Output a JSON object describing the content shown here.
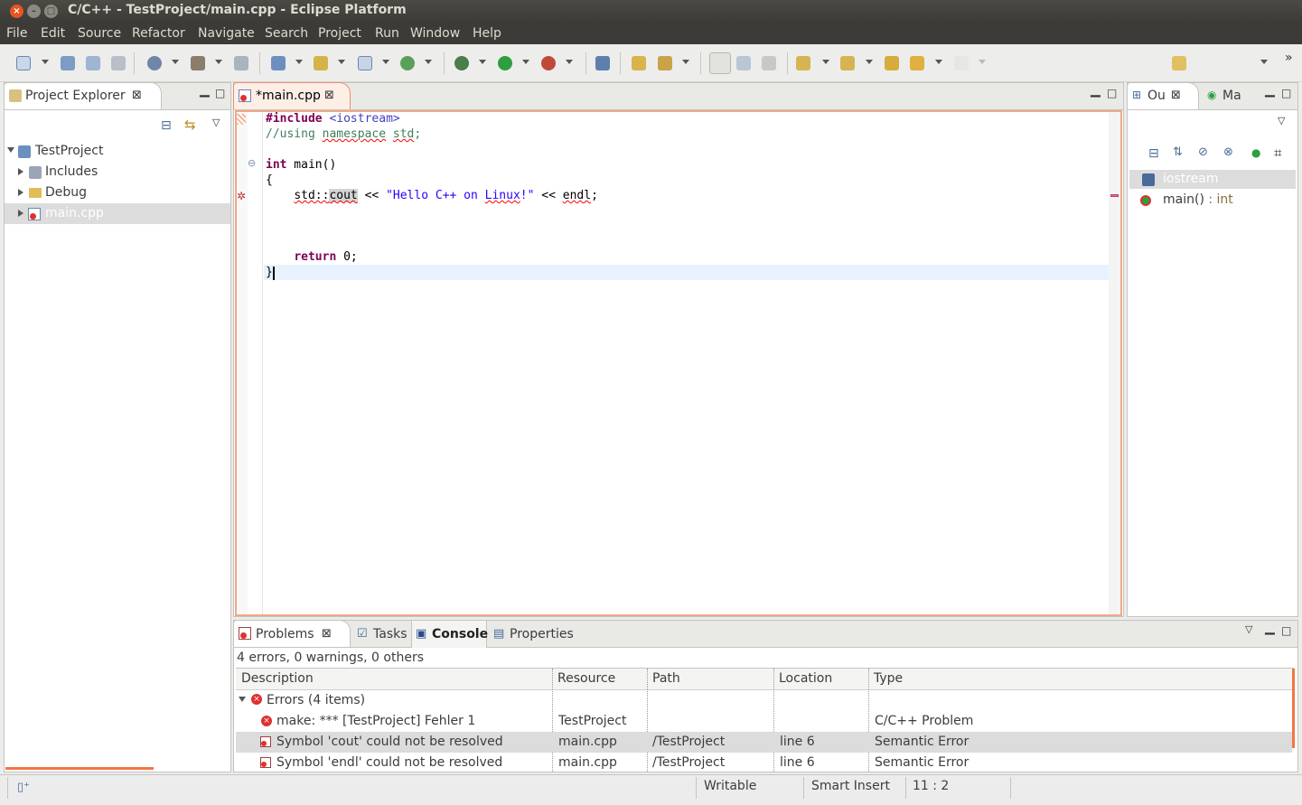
{
  "window": {
    "title": "C/C++ - TestProject/main.cpp - Eclipse Platform"
  },
  "menu": [
    "File",
    "Edit",
    "Source",
    "Refactor",
    "Navigate",
    "Search",
    "Project",
    "Run",
    "Window",
    "Help"
  ],
  "explorer": {
    "title": "Project Explorer",
    "project": "TestProject",
    "items": [
      {
        "label": "Includes",
        "icon": "includes-icon"
      },
      {
        "label": "Debug",
        "icon": "folder-icon"
      },
      {
        "label": "main.cpp",
        "icon": "cpp-file-error-icon"
      }
    ]
  },
  "editor": {
    "tab": "*main.cpp",
    "lines": {
      "l1_kw": "#include",
      "l1_inc": "<iostream>",
      "l2_pre": "//using ",
      "l2_ns": "namespace",
      "l2_sp": " ",
      "l2_std": "std",
      "l2_end": ";",
      "l4_kw": "int",
      "l4_rest": " main()",
      "l5": "{",
      "l6_indent": "    ",
      "l6_std": "std::",
      "l6_cout": "cout",
      "l6_op": " << ",
      "l6_str1": "\"Hello C++ on ",
      "l6_linux": "Linux",
      "l6_str2": "!\"",
      "l6_op2": " << ",
      "l6_endl": "endl",
      "l6_end": ";",
      "l9_indent": "    ",
      "l9_kw": "return",
      "l9_rest": " 0;",
      "l10": "}"
    }
  },
  "outline": {
    "tabs": [
      "Ou",
      "Ma"
    ],
    "items": [
      {
        "label": "iostream",
        "type": ""
      },
      {
        "label": "main()",
        "type": " : int"
      }
    ]
  },
  "bottom": {
    "tabs": [
      "Problems",
      "Tasks",
      "Console",
      "Properties"
    ],
    "summary": "4 errors, 0 warnings, 0 others",
    "columns": [
      "Description",
      "Resource",
      "Path",
      "Location",
      "Type"
    ],
    "group": "Errors (4 items)",
    "rows": [
      {
        "description": "make: *** [TestProject] Fehler 1",
        "resource": "TestProject",
        "path": "",
        "location": "",
        "type": "C/C++ Problem"
      },
      {
        "description": "Symbol 'cout' could not be resolved",
        "resource": "main.cpp",
        "path": "/TestProject",
        "location": "line 6",
        "type": "Semantic Error"
      },
      {
        "description": "Symbol 'endl' could not be resolved",
        "resource": "main.cpp",
        "path": "/TestProject",
        "location": "line 6",
        "type": "Semantic Error"
      }
    ]
  },
  "statusbar": {
    "mode": "Writable",
    "insert": "Smart Insert",
    "position": "11 : 2"
  },
  "colors": {
    "accent": "#f07746",
    "selection": "#dcdcdc",
    "error": "#e03030"
  }
}
